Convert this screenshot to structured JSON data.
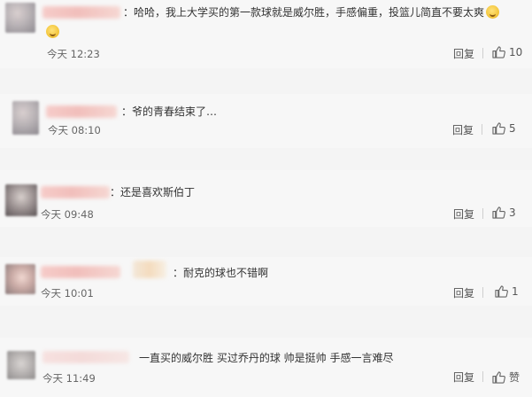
{
  "comments": [
    {
      "text": "：哈哈，我上大学买的第一款球就是威尔胜，手感偏重，投篮儿简直不要太爽",
      "time": "今天 12:23",
      "reply_label": "回复",
      "likes": "10",
      "emojis": [
        "laugh-emoji",
        "laugh-emoji"
      ]
    },
    {
      "text": "：爷的青春结束了…",
      "time": "今天 08:10",
      "reply_label": "回复",
      "likes": "5"
    },
    {
      "text": "：还是喜欢斯伯丁",
      "time": "今天 09:48",
      "reply_label": "回复",
      "likes": "3"
    },
    {
      "text": "：耐克的球也不错啊",
      "time": "今天 10:01",
      "reply_label": "回复",
      "likes": "1"
    },
    {
      "text": "一直买的威尔胜 买过乔丹的球 帅是挺帅 手感一言难尽",
      "time": "今天 11:49",
      "reply_label": "回复",
      "likes": "赞"
    }
  ],
  "icons": {
    "like": "thumbs-up-icon",
    "emoji": "laugh-emoji"
  }
}
